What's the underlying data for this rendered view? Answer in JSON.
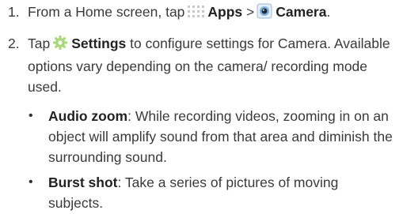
{
  "steps": [
    {
      "number": "1.",
      "prefix": "From a Home screen, tap",
      "apps_icon": "apps-grid-icon",
      "apps_label": "Apps",
      "separator": ">",
      "camera_icon": "camera-icon",
      "camera_label": "Camera",
      "suffix": "."
    },
    {
      "number": "2.",
      "prefix": "Tap",
      "settings_icon": "gear-icon",
      "settings_label": "Settings",
      "text": "to configure settings for Camera. Available options vary depending on the camera/ recording mode used."
    }
  ],
  "bullets": [
    {
      "marker": "•",
      "title": "Audio zoom",
      "text": ": While recording videos, zooming in on an object will amplify sound from that area and diminish the surrounding sound."
    },
    {
      "marker": "•",
      "title": "Burst shot",
      "text": ": Take a series of pictures of moving subjects."
    }
  ],
  "colors": {
    "text": "#3a3a3a",
    "bold": "#222222",
    "apps_icon": "#cccccc",
    "gear_icon": "#a8d878",
    "camera_ring": "#7fb0e0"
  }
}
